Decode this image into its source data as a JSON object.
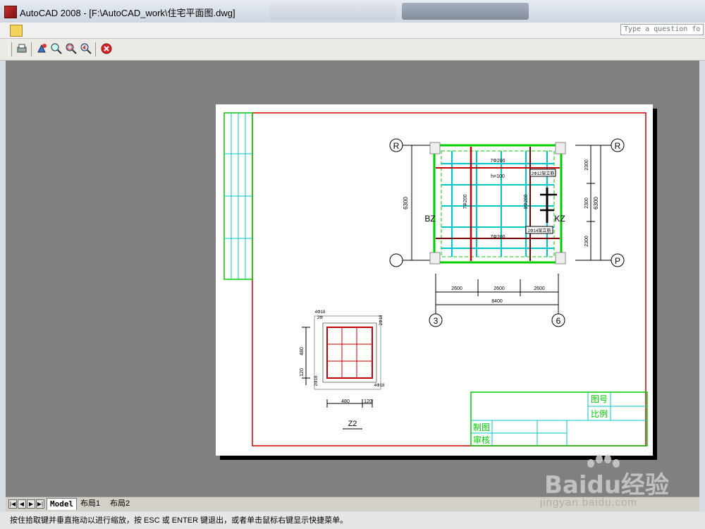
{
  "window": {
    "title": "AutoCAD 2008 - [F:\\AutoCAD_work\\住宅平面图.dwg]"
  },
  "help_search": {
    "placeholder": "Type a question for help"
  },
  "toolbar_icons": [
    "print-preview-icon",
    "pan-icon",
    "zoom-realtime-icon",
    "zoom-window-icon",
    "zoom-previous-icon",
    "close-preview-icon"
  ],
  "drawing": {
    "grid_labels": {
      "top_left": "R",
      "top_right": "R",
      "bottom_right": "P",
      "bottom_left": "3",
      "bottom_right_axis": "6"
    },
    "plan_labels": {
      "top_rebar": "7Φ200",
      "top_h": "h=100",
      "tag_1": "2Φ12架立筋",
      "tag_2": "2Φ14架立筋",
      "mid_rebar_left": "7Φ200",
      "mid_rebar_right": "9Φ200",
      "bottom_rebar": "7Φ200",
      "bz": "BZ",
      "kz": "KZ"
    },
    "left_dim": "6300",
    "right_dims": [
      "2300",
      "2300",
      "2300"
    ],
    "right_dim_total": "6300",
    "bottom_dims": [
      "2600",
      "2600",
      "2600"
    ],
    "bottom_dim_total": "8400",
    "column_detail": {
      "top_label": "4Φ18",
      "top_sub": "2Φ",
      "side_dim": "480",
      "side_dim_small": "120",
      "side_bars": "2Φ18",
      "right_top": "2Φ18",
      "right_bottom": "4Φ18",
      "bottom_dim": "480",
      "bottom_dim_small": "120",
      "name": "Z2"
    },
    "title_block": {
      "drawing_no": "图号",
      "scale": "比例",
      "drawn_by": "制图",
      "checked_by": "审核"
    }
  },
  "layout_tabs": {
    "model": "Model",
    "layout1": "布局1",
    "layout2": "布局2"
  },
  "status_text": "按住拾取键并垂直拖动以进行缩放，按 ESC 或 ENTER 键退出，或者单击鼠标右键显示快捷菜单。",
  "watermark": {
    "brand": "Baidu经验",
    "url": "jingyan.baidu.com"
  },
  "colors": {
    "canvas": "#808080",
    "border_red": "#cc0000",
    "cad_green": "#00cc00",
    "cad_cyan": "#00c8c8",
    "cad_yellow": "#c8c800"
  }
}
